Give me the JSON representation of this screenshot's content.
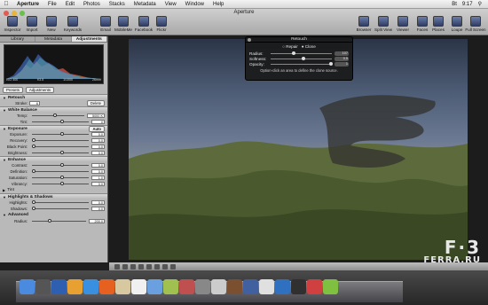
{
  "menubar": {
    "apple": "",
    "items": [
      "Aperture",
      "File",
      "Edit",
      "Photos",
      "Stacks",
      "Metadata",
      "View",
      "Window",
      "Help"
    ],
    "right": [
      "Bt",
      "9:17"
    ]
  },
  "window": {
    "title": "Aperture"
  },
  "toolbar": {
    "left": [
      {
        "label": "Inspector",
        "icon": "inspector-icon"
      },
      {
        "label": "Import",
        "icon": "import-icon"
      },
      {
        "label": "New",
        "icon": "new-icon"
      },
      {
        "label": "Keywords",
        "icon": "keywords-icon"
      },
      {
        "label": "Email",
        "icon": "email-icon"
      },
      {
        "label": "MobileMe",
        "icon": "mobileme-icon"
      },
      {
        "label": "Facebook",
        "icon": "facebook-icon"
      },
      {
        "label": "Flickr",
        "icon": "flickr-icon"
      }
    ],
    "right": [
      {
        "label": "Browser",
        "icon": "browser-icon"
      },
      {
        "label": "Split View",
        "icon": "split-view-icon"
      },
      {
        "label": "Viewer",
        "icon": "viewer-icon"
      },
      {
        "label": "Faces",
        "icon": "faces-icon"
      },
      {
        "label": "Places",
        "icon": "places-icon"
      },
      {
        "label": "Loupe",
        "icon": "loupe-icon"
      },
      {
        "label": "Full Screen",
        "icon": "full-screen-icon"
      }
    ]
  },
  "inspector": {
    "tabs": [
      "Library",
      "Metadata",
      "Adjustments"
    ],
    "active_tab": "Adjustments",
    "histogram": {
      "iso": "ISO 400",
      "aperture": "f/3.5",
      "shutter": "1/1000",
      "focal": "26mm"
    },
    "presets_label": "Presets",
    "adjustments_label": "Adjustments",
    "retouch": {
      "title": "Retouch",
      "stroke_label": "Stroke:",
      "stroke_value": "6",
      "delete_label": "Delete"
    },
    "white_balance": {
      "title": "White Balance",
      "temp_label": "Temp:",
      "temp_value": "5000 K",
      "tint_label": "Tint:",
      "tint_value": "0"
    },
    "exposure": {
      "title": "Exposure",
      "auto": "Auto",
      "rows": [
        {
          "label": "Exposure:",
          "value": "0.0"
        },
        {
          "label": "Recovery:",
          "value": "0.0"
        },
        {
          "label": "Black Point:",
          "value": "0.0"
        },
        {
          "label": "Brightness:",
          "value": "0.0"
        }
      ]
    },
    "enhance": {
      "title": "Enhance",
      "rows": [
        {
          "label": "Contrast:",
          "value": "0.0"
        },
        {
          "label": "Definition:",
          "value": "0.0"
        },
        {
          "label": "Saturation:",
          "value": "1.0"
        },
        {
          "label": "Vibrancy:",
          "value": "0.0"
        }
      ],
      "tint_label": "Tint"
    },
    "highlights": {
      "title": "Highlights & Shadows",
      "rows": [
        {
          "label": "Highlights:",
          "value": "0.0"
        },
        {
          "label": "Shadows:",
          "value": "0.0"
        }
      ],
      "advanced_label": "Advanced",
      "radius_label": "Radius:",
      "radius_value": "200.0"
    }
  },
  "hud": {
    "title": "Retouch",
    "repair": "Repair",
    "clone": "Clone",
    "radius_label": "Radius:",
    "radius_value": "107",
    "softness_label": "Softness:",
    "softness_value": "0.5",
    "opacity_label": "Opacity:",
    "opacity_value": "1",
    "hint": "Option-click an area to define the clone source."
  },
  "watermark": {
    "logo": "F·3",
    "text": "FERRA.RU"
  },
  "colors": {
    "accent": "#3d6bd6",
    "histogram_red": "#e25a4a",
    "histogram_green": "#58c35a",
    "histogram_blue": "#4b7de8"
  }
}
